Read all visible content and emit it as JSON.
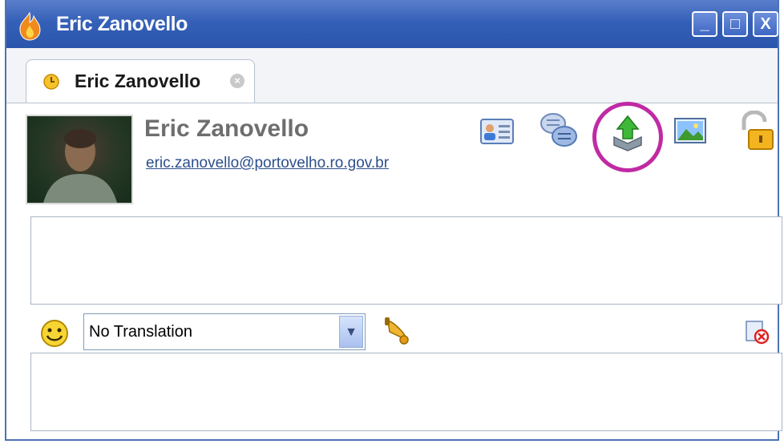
{
  "window": {
    "title": "Eric Zanovello",
    "minimize_label": "_",
    "maximize_label": "□",
    "close_label": "X"
  },
  "tab": {
    "label": "Eric Zanovello",
    "close_glyph": "×"
  },
  "contact": {
    "name": "Eric Zanovello",
    "email": "eric.zanovello@portovelho.ro.gov.br"
  },
  "toolbar": {
    "icons": [
      "contact-card-icon",
      "chat-bubbles-icon",
      "send-file-icon",
      "picture-icon",
      "lock-icon"
    ]
  },
  "translation": {
    "selected": "No Translation"
  },
  "colors": {
    "titlebar": "#3560b8",
    "highlight": "#c02aa3",
    "email_link": "#2d4f8c"
  }
}
